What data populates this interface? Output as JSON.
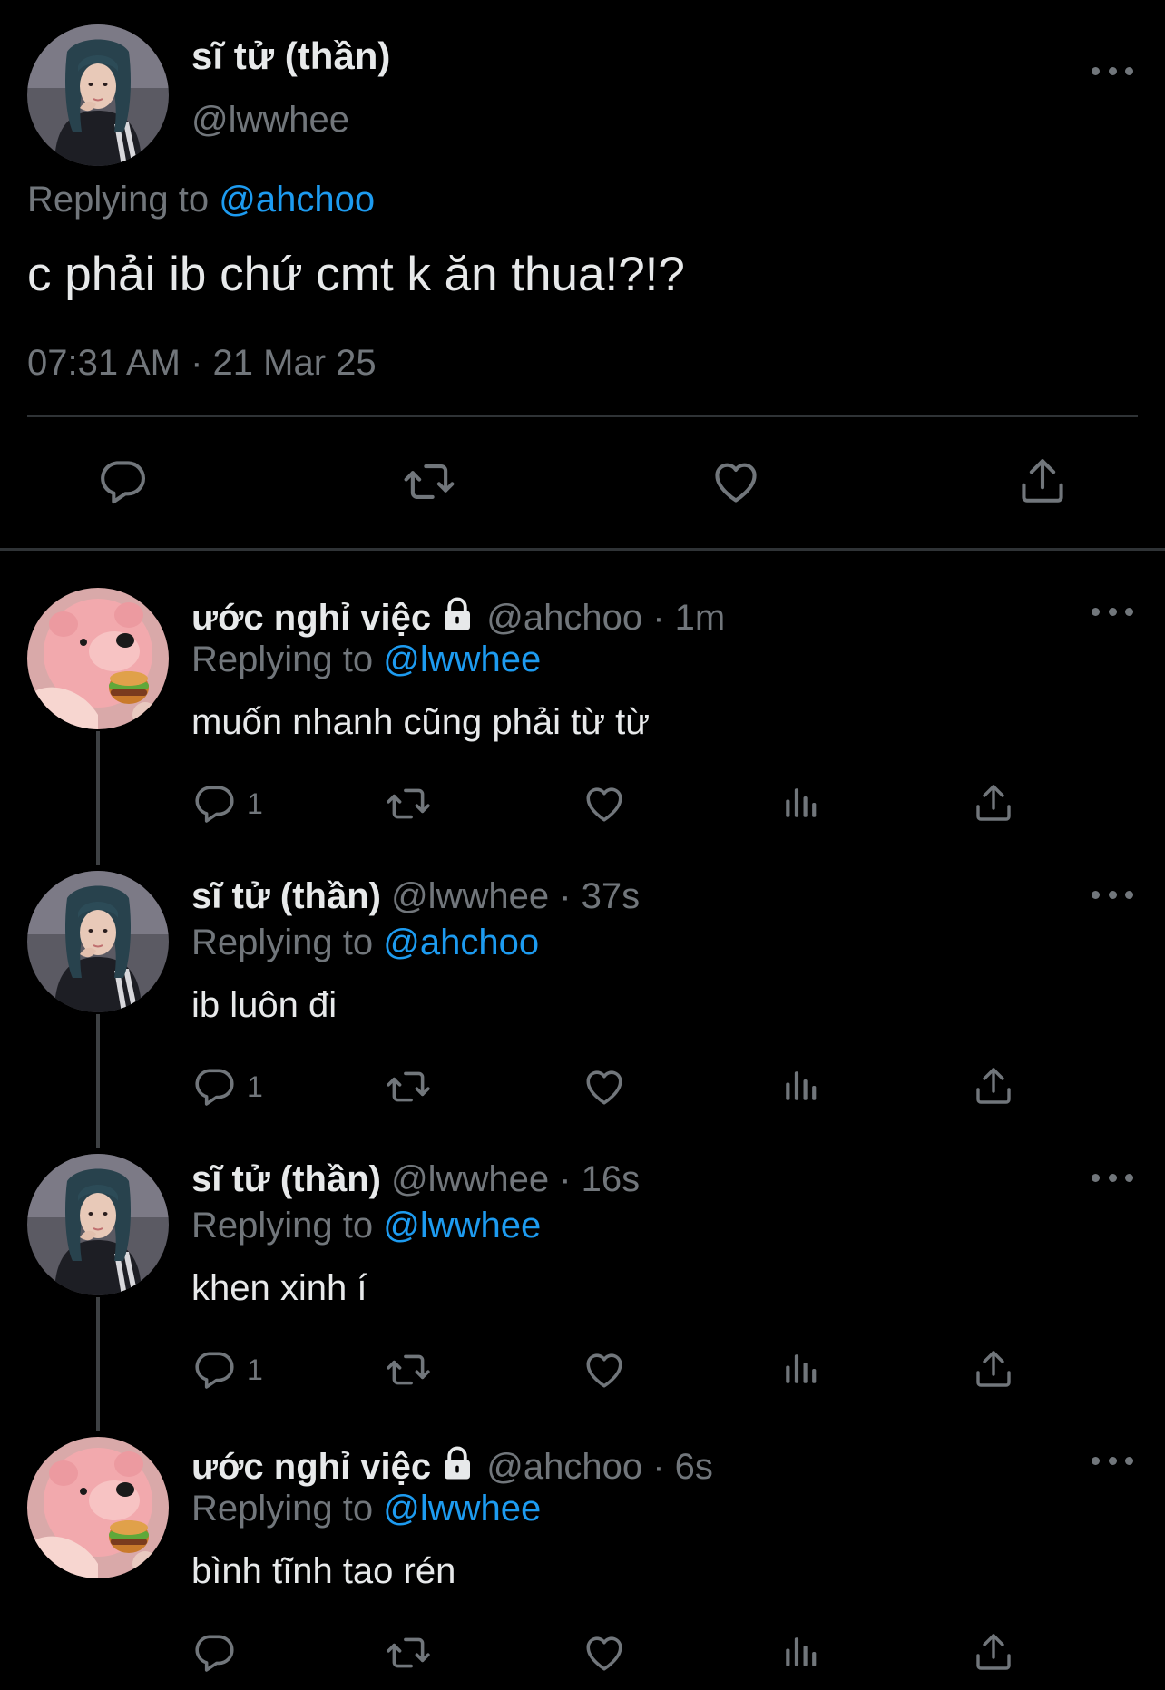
{
  "main_tweet": {
    "display_name": "sĩ tử (thần)",
    "handle": "@lwwhee",
    "replying_prefix": "Replying to ",
    "replying_to": "@ahchoo",
    "text": "c phải ib chứ cmt k ăn thua!?!?",
    "timestamp": "07:31 AM · 21 Mar 25"
  },
  "replies": [
    {
      "display_name": "ước nghỉ việc",
      "locked": true,
      "handle": "@ahchoo",
      "time": "1m",
      "replying_prefix": "Replying to ",
      "replying_to": "@lwwhee",
      "text": "muốn nhanh cũng phải từ từ",
      "reply_count": "1"
    },
    {
      "display_name": "sĩ tử (thần)",
      "locked": false,
      "handle": "@lwwhee",
      "time": "37s",
      "replying_prefix": "Replying to ",
      "replying_to": "@ahchoo",
      "text": "ib luôn đi",
      "reply_count": "1"
    },
    {
      "display_name": "sĩ tử (thần)",
      "locked": false,
      "handle": "@lwwhee",
      "time": "16s",
      "replying_prefix": "Replying to ",
      "replying_to": "@lwwhee",
      "text": "khen xinh í",
      "reply_count": "1"
    },
    {
      "display_name": "ước nghỉ việc",
      "locked": true,
      "handle": "@ahchoo",
      "time": "6s",
      "replying_prefix": "Replying to ",
      "replying_to": "@lwwhee",
      "text": "bình tĩnh tao rén",
      "reply_count": ""
    }
  ],
  "meta_separator": " · ",
  "icons": {
    "reply": "reply-icon",
    "retweet": "retweet-icon",
    "like": "heart-icon",
    "views": "views-icon",
    "share": "share-icon",
    "more": "more-icon",
    "lock": "lock-icon"
  },
  "colors": {
    "background": "#000000",
    "text": "#e7e9ea",
    "secondary": "#71767b",
    "link": "#1d9bf0"
  }
}
